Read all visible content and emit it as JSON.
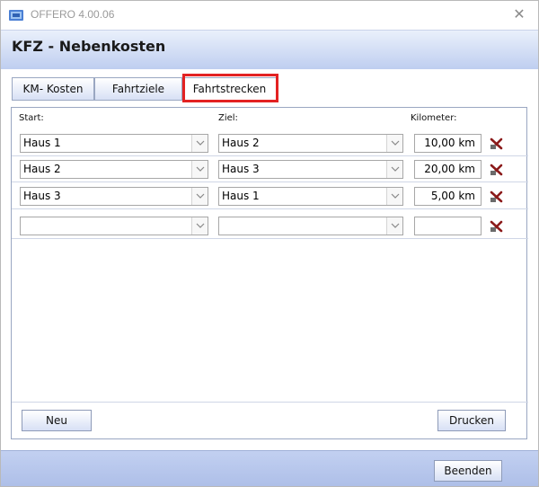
{
  "window": {
    "title": "OFFERO 4.00.06",
    "close_glyph": "✕"
  },
  "header": {
    "title": "KFZ - Nebenkosten"
  },
  "tabs": [
    {
      "label": "KM- Kosten",
      "active": false
    },
    {
      "label": "Fahrtziele",
      "active": false
    },
    {
      "label": "Fahrtstrecken",
      "active": true
    }
  ],
  "columns": {
    "start": "Start:",
    "ziel": "Ziel:",
    "kilometer": "Kilometer:"
  },
  "rows": [
    {
      "start": "Haus 1",
      "ziel": "Haus 2",
      "km": "10,00  km"
    },
    {
      "start": "Haus 2",
      "ziel": "Haus 3",
      "km": "20,00  km"
    },
    {
      "start": "Haus 3",
      "ziel": "Haus 1",
      "km": "5,00  km"
    },
    {
      "start": "",
      "ziel": "",
      "km": ""
    }
  ],
  "buttons": {
    "new": "Neu",
    "print": "Drucken",
    "close": "Beenden"
  },
  "colors": {
    "highlight": "#e32222",
    "header_bg": "#bfcef0",
    "footer_bg": "#aebfe8"
  },
  "icons": {
    "app": "offero-app-icon",
    "delete": "delete-row-icon",
    "dropdown": "chevron-down-icon"
  }
}
